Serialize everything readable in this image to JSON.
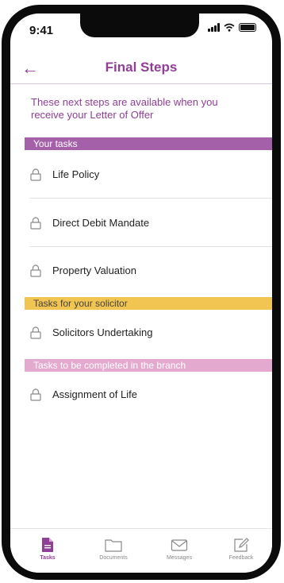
{
  "status_bar": {
    "time": "9:41"
  },
  "header": {
    "back_icon": "arrow-left-icon",
    "title": "Final Steps"
  },
  "intro_text": "These next steps are available when you receive your Letter of Offer",
  "sections": [
    {
      "title": "Your tasks",
      "color": "#a560aa",
      "tasks": [
        "Life Policy",
        "Direct Debit Mandate",
        "Property Valuation"
      ]
    },
    {
      "title": "Tasks for your solicitor",
      "color": "#f2c451",
      "tasks": [
        "Solicitors Undertaking"
      ]
    },
    {
      "title": "Tasks to be completed in the branch",
      "color": "#e4a9cf",
      "tasks": [
        "Assignment of Life"
      ]
    }
  ],
  "tab_bar": {
    "tabs": [
      {
        "label": "Tasks",
        "icon": "document-filled-icon",
        "active": true
      },
      {
        "label": "Documents",
        "icon": "folder-icon",
        "active": false
      },
      {
        "label": "Messages",
        "icon": "envelope-icon",
        "active": false
      },
      {
        "label": "Feedback",
        "icon": "pencil-square-icon",
        "active": false
      }
    ]
  },
  "colors": {
    "accent": "#8f3f96"
  }
}
